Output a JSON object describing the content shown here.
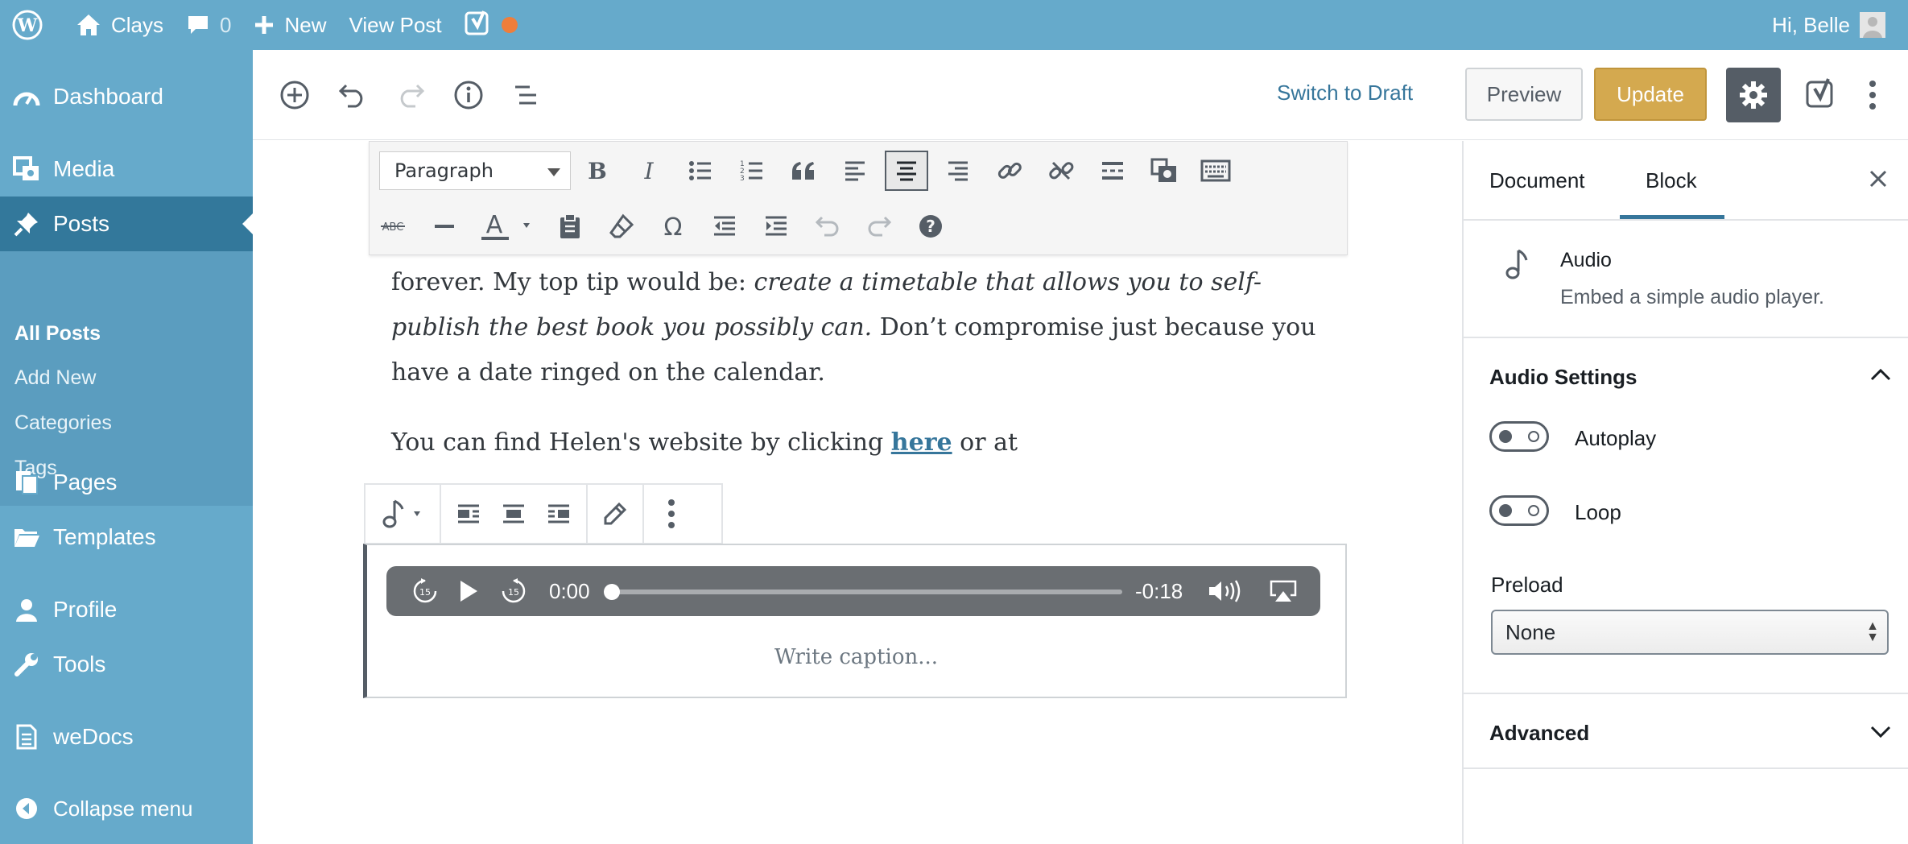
{
  "admin_bar": {
    "site_name": "Clays",
    "comments_count": "0",
    "new_label": "New",
    "view_post_label": "View Post",
    "greeting": "Hi, Belle"
  },
  "sidebar": {
    "items": [
      {
        "label": "Dashboard",
        "icon": "dashboard-icon"
      },
      {
        "label": "Media",
        "icon": "media-icon"
      },
      {
        "label": "Posts",
        "icon": "pin-icon"
      },
      {
        "label": "Pages",
        "icon": "pages-icon"
      },
      {
        "label": "Templates",
        "icon": "folder-icon"
      },
      {
        "label": "Profile",
        "icon": "user-icon"
      },
      {
        "label": "Tools",
        "icon": "wrench-icon"
      },
      {
        "label": "weDocs",
        "icon": "document-icon"
      },
      {
        "label": "Collapse menu",
        "icon": "collapse-icon"
      }
    ],
    "submenu": [
      "All Posts",
      "Add New",
      "Categories",
      "Tags"
    ]
  },
  "header": {
    "switch_to_draft": "Switch to Draft",
    "preview": "Preview",
    "update": "Update"
  },
  "classic_toolbar": {
    "format_select": "Paragraph"
  },
  "content": {
    "line1_plain": "forever. My top tip would be: ",
    "line1_em": "create a timetable that allows you to self-",
    "line2_em": "publish the best book you possibly can.",
    "line2_plain": " Don’t compromise just because you",
    "line3": "have a date ringed on the calendar.",
    "line4_before": "You can find Helen's website by clicking ",
    "line4_link": "here",
    "line4_after": " or at"
  },
  "audio": {
    "current_time": "0:00",
    "remaining_time": "-0:18",
    "progress": 0,
    "caption_placeholder": "Write caption..."
  },
  "inspector": {
    "tab_document": "Document",
    "tab_block": "Block",
    "block_name": "Audio",
    "block_description": "Embed a simple audio player.",
    "audio_settings_title": "Audio Settings",
    "autoplay_label": "Autoplay",
    "autoplay_on": false,
    "loop_label": "Loop",
    "loop_on": false,
    "preload_label": "Preload",
    "preload_value": "None",
    "advanced_title": "Advanced"
  },
  "colors": {
    "admin_bar": "#66aacb",
    "sidebar_active": "#33789b",
    "accent": "#36769b",
    "update_button": "#d4a94f",
    "notification_dot": "#ef7e3b"
  }
}
